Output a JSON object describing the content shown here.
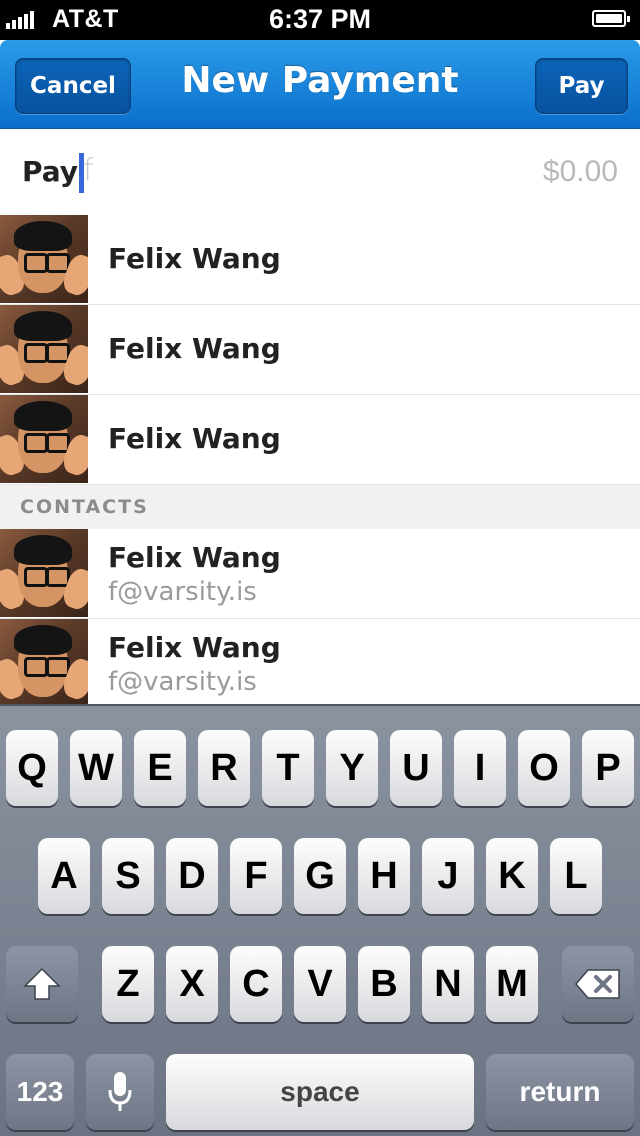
{
  "status": {
    "carrier": "AT&T",
    "time": "6:37 PM"
  },
  "nav": {
    "title": "New Payment",
    "cancel_label": "Cancel",
    "pay_label": "Pay"
  },
  "pay_row": {
    "label": "Pay",
    "typed": "f",
    "amount": "$0.00"
  },
  "recent": [
    {
      "name": "Felix Wang"
    },
    {
      "name": "Felix Wang"
    },
    {
      "name": "Felix Wang"
    }
  ],
  "contacts_header": "CONTACTS",
  "contacts": [
    {
      "name": "Felix Wang",
      "email": "f@varsity.is"
    },
    {
      "name": "Felix Wang",
      "email": "f@varsity.is"
    }
  ],
  "keyboard": {
    "row1": [
      "Q",
      "W",
      "E",
      "R",
      "T",
      "Y",
      "U",
      "I",
      "O",
      "P"
    ],
    "row2": [
      "A",
      "S",
      "D",
      "F",
      "G",
      "H",
      "J",
      "K",
      "L"
    ],
    "row3": [
      "Z",
      "X",
      "C",
      "V",
      "B",
      "N",
      "M"
    ],
    "numbers_label": "123",
    "space_label": "space",
    "return_label": "return"
  }
}
